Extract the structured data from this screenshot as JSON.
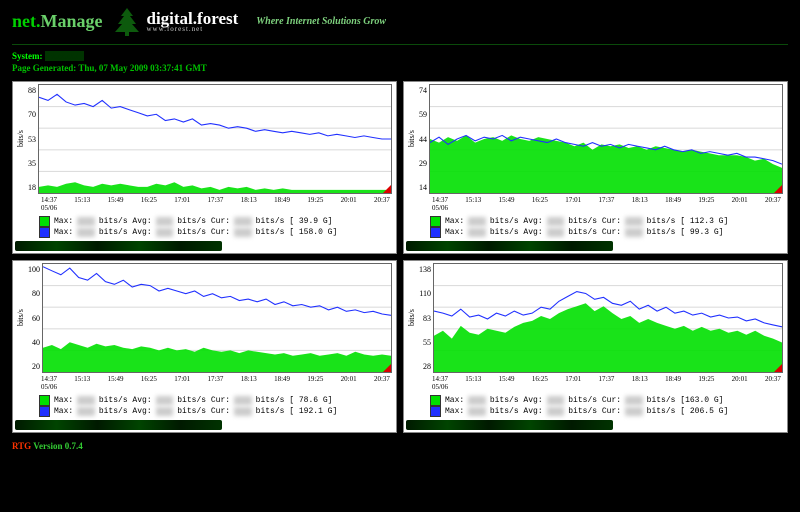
{
  "header": {
    "brand_left": "net.",
    "brand_right": "Manage",
    "df_left": "digital",
    "df_dot": ".",
    "df_right": "forest",
    "df_sub": "www.forest.net",
    "tagline": "Where Internet Solutions Grow"
  },
  "system": {
    "label": "System:",
    "value_hidden": "xxxxxx"
  },
  "page_generated": "Page Generated: Thu, 07 May 2009 03:37:41 GMT",
  "chart_common": {
    "version": "RTG 0.7.4",
    "ylabel": "bits/s",
    "xticks": [
      "14:37",
      "15:13",
      "15:49",
      "16:25",
      "17:01",
      "17:37",
      "18:13",
      "18:49",
      "19:25",
      "20:01",
      "20:37"
    ],
    "date": "05/06",
    "legend_prefix": "Max:",
    "legend_after_max": "bits/s Avg:",
    "legend_after_avg": "bits/s Cur:",
    "legend_after_cur": "bits/s"
  },
  "chart_data": [
    {
      "type": "line",
      "title": "",
      "ylabel": "bits/s",
      "ylim": [
        18,
        88
      ],
      "yticks": [
        "88",
        "70",
        "53",
        "35",
        "18"
      ],
      "series": [
        {
          "name": "green",
          "color": "#00e000",
          "legend_total": "[ 39.9 G]",
          "values": [
            22,
            23,
            22,
            24,
            25,
            23,
            22,
            24,
            23,
            24,
            23,
            22,
            22,
            24,
            23,
            25,
            22,
            23,
            21,
            22,
            20,
            22,
            21,
            22,
            20,
            21,
            20,
            21,
            20,
            20,
            20,
            20,
            20,
            20,
            20,
            20,
            20,
            20,
            20,
            20
          ]
        },
        {
          "name": "blue",
          "color": "#2030ff",
          "legend_total": "[ 158.0 G]",
          "values": [
            80,
            78,
            82,
            77,
            75,
            76,
            74,
            78,
            73,
            74,
            72,
            70,
            68,
            69,
            65,
            66,
            64,
            66,
            62,
            63,
            62,
            60,
            61,
            60,
            58,
            59,
            58,
            57,
            58,
            57,
            56,
            57,
            55,
            56,
            55,
            54,
            55,
            54,
            53,
            53
          ]
        }
      ]
    },
    {
      "type": "line",
      "title": "",
      "ylabel": "bits/s",
      "ylim": [
        14,
        74
      ],
      "yticks": [
        "74",
        "59",
        "44",
        "29",
        "14"
      ],
      "series": [
        {
          "name": "green",
          "color": "#00e000",
          "legend_total": "[ 112.3 G]",
          "values": [
            44,
            42,
            45,
            43,
            46,
            42,
            44,
            45,
            43,
            46,
            44,
            43,
            45,
            44,
            43,
            42,
            40,
            42,
            38,
            41,
            40,
            41,
            39,
            40,
            38,
            40,
            39,
            38,
            37,
            38,
            37,
            36,
            35,
            35,
            35,
            34,
            32,
            33,
            30,
            28
          ]
        },
        {
          "name": "blue",
          "color": "#2030ff",
          "legend_total": "[ 99.3 G]",
          "values": [
            42,
            45,
            41,
            44,
            46,
            43,
            45,
            44,
            46,
            43,
            45,
            44,
            43,
            42,
            44,
            42,
            41,
            40,
            42,
            40,
            41,
            39,
            41,
            40,
            39,
            38,
            40,
            38,
            37,
            38,
            36,
            37,
            36,
            35,
            36,
            34,
            34,
            33,
            32,
            30
          ]
        }
      ]
    },
    {
      "type": "line",
      "title": "",
      "ylabel": "bits/s",
      "ylim": [
        20,
        100
      ],
      "yticks": [
        "100",
        "80",
        "60",
        "40",
        "20"
      ],
      "series": [
        {
          "name": "green",
          "color": "#00e000",
          "legend_total": "[ 78.6 G]",
          "values": [
            38,
            40,
            37,
            42,
            40,
            38,
            41,
            39,
            40,
            38,
            37,
            39,
            38,
            36,
            38,
            36,
            37,
            35,
            38,
            36,
            35,
            36,
            34,
            36,
            35,
            34,
            33,
            34,
            32,
            33,
            34,
            32,
            33,
            34,
            32,
            35,
            33,
            32,
            33,
            32
          ]
        },
        {
          "name": "blue",
          "color": "#2030ff",
          "legend_total": "[ 192.1 G]",
          "values": [
            98,
            95,
            92,
            97,
            90,
            88,
            93,
            87,
            85,
            88,
            83,
            85,
            84,
            80,
            82,
            80,
            78,
            80,
            76,
            78,
            75,
            76,
            73,
            74,
            72,
            74,
            70,
            72,
            69,
            70,
            68,
            69,
            66,
            68,
            65,
            66,
            64,
            65,
            63,
            62
          ]
        }
      ]
    },
    {
      "type": "line",
      "title": "",
      "ylabel": "bits/s",
      "ylim": [
        28,
        138
      ],
      "yticks": [
        "138",
        "110",
        "83",
        "55",
        "28"
      ],
      "series": [
        {
          "name": "green",
          "color": "#00e000",
          "legend_total": "[163.0 G]",
          "values": [
            65,
            70,
            62,
            75,
            68,
            66,
            72,
            70,
            68,
            74,
            78,
            80,
            85,
            82,
            88,
            92,
            95,
            98,
            90,
            95,
            88,
            82,
            85,
            78,
            82,
            78,
            75,
            72,
            75,
            70,
            74,
            70,
            72,
            68,
            70,
            66,
            70,
            65,
            62,
            58
          ]
        },
        {
          "name": "blue",
          "color": "#2030ff",
          "legend_total": "[ 206.5 G]",
          "values": [
            90,
            88,
            85,
            92,
            84,
            86,
            82,
            88,
            85,
            90,
            86,
            88,
            94,
            92,
            100,
            105,
            110,
            108,
            102,
            104,
            98,
            96,
            100,
            92,
            96,
            90,
            94,
            88,
            90,
            86,
            88,
            84,
            86,
            83,
            84,
            80,
            82,
            78,
            76,
            74
          ]
        }
      ]
    }
  ],
  "footer": {
    "rtg": "RTG",
    "version": "Version 0.7.4"
  }
}
